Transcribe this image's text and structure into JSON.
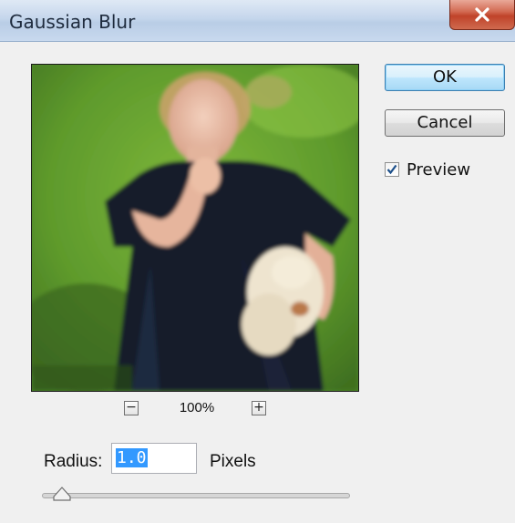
{
  "window": {
    "title": "Gaussian Blur"
  },
  "buttons": {
    "ok_label": "OK",
    "cancel_label": "Cancel"
  },
  "preview": {
    "label": "Preview",
    "checked": true
  },
  "zoom": {
    "level": "100%",
    "zoom_out_symbol": "−",
    "zoom_in_symbol": "+"
  },
  "radius": {
    "label": "Radius:",
    "value": "1.0",
    "unit": "Pixels",
    "slider_fraction": 0.05
  },
  "icons": {
    "close": "close-icon",
    "check": "checkmark-icon",
    "zoom_out": "minus-icon",
    "zoom_in": "plus-icon",
    "slider_thumb": "slider-thumb-icon"
  },
  "colors": {
    "ok_accent": "#3c7fb1",
    "selection": "#3399ff",
    "close_button": "#c0432a",
    "titlebar": "#c5d6ec"
  }
}
